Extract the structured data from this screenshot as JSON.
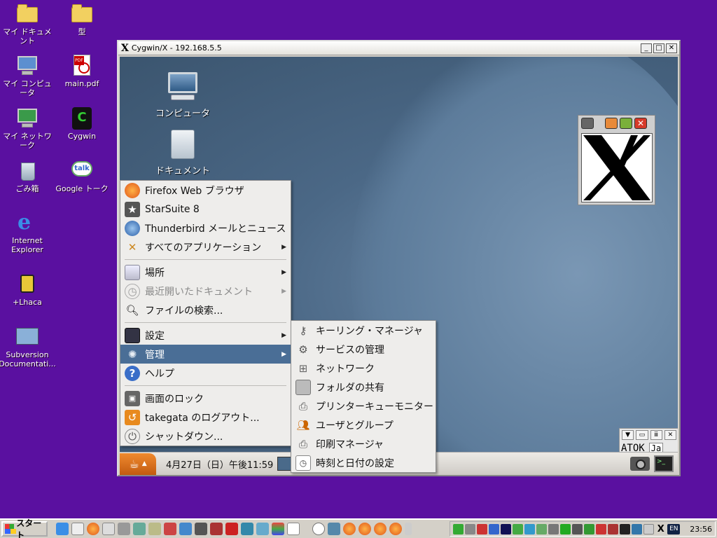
{
  "desktop_icons": {
    "my_documents": "マイ ドキュメント",
    "kata": "型",
    "my_computer": "マイ コンピュータ",
    "main_pdf": "main.pdf",
    "my_network": "マイ ネットワーク",
    "cygwin": "Cygwin",
    "recycle": "ごみ箱",
    "google_talk": "Google トーク",
    "ie_line1": "Internet",
    "ie_line2": "Explorer",
    "lhaca": "+Lhaca",
    "svn_line1": "Subversion",
    "svn_line2": "Documentati..."
  },
  "xwindow": {
    "title": "Cygwin/X - 192.168.5.5",
    "logo": "X"
  },
  "gnome_desktop": {
    "computer": "コンピュータ",
    "documents": "ドキュメント"
  },
  "main_menu": {
    "firefox": "Firefox Web ブラウザ",
    "starsuite": "StarSuite 8",
    "thunderbird": "Thunderbird メールとニュース",
    "all_apps": "すべてのアプリケーション",
    "places": "場所",
    "recent": "最近開いたドキュメント",
    "search": "ファイルの検索...",
    "settings": "設定",
    "admin": "管理",
    "help": "ヘルプ",
    "lock": "画面のロック",
    "logout": "takegata のログアウト...",
    "shutdown": "シャットダウン..."
  },
  "admin_submenu": {
    "keyring": "キーリング・マネージャ",
    "services": "サービスの管理",
    "network": "ネットワーク",
    "folder_share": "フォルダの共有",
    "printer_queue": "プリンターキューモニター",
    "users_groups": "ユーザとグループ",
    "print_manager": "印刷マネージャ",
    "datetime": "時刻と日付の設定"
  },
  "gnome_panel": {
    "clock": "4月27日（日）午後11:59"
  },
  "atok": {
    "name": "ATOK",
    "mode": "Ja"
  },
  "taskbar": {
    "start": "スタート",
    "clock": "23:56",
    "lang": "EN"
  },
  "colors": {
    "desktop": "#5a10a0",
    "menu_highlight": "#4a6e96",
    "gnome_menu_button": "#e0741e"
  }
}
